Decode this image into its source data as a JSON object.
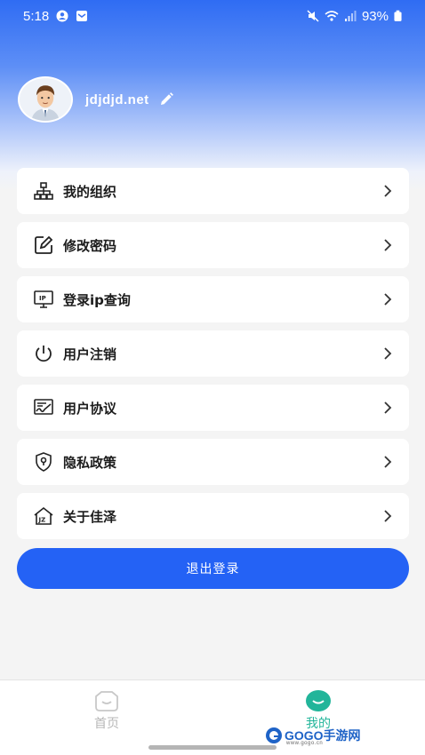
{
  "status_bar": {
    "time": "5:18",
    "battery": "93%"
  },
  "profile": {
    "username": "jdjdjd.net"
  },
  "menu": {
    "items": [
      {
        "label": "我的组织",
        "icon": "org-chart-icon"
      },
      {
        "label": "修改密码",
        "icon": "edit-square-icon"
      },
      {
        "label": "登录ip查询",
        "icon": "ip-monitor-icon"
      },
      {
        "label": "用户注销",
        "icon": "power-icon"
      },
      {
        "label": "用户协议",
        "icon": "agreement-icon"
      },
      {
        "label": "隐私政策",
        "icon": "shield-icon"
      },
      {
        "label": "关于佳泽",
        "icon": "about-home-icon"
      }
    ]
  },
  "logout_label": "退出登录",
  "tabbar": {
    "home_label": "首页",
    "mine_label": "我的"
  },
  "watermark": {
    "brand": "GOGO手游网",
    "sub": "www.gogo.cn"
  },
  "colors": {
    "primary": "#2462f5",
    "tab_active": "#22b59a",
    "tab_inactive": "#b7b7b7"
  }
}
